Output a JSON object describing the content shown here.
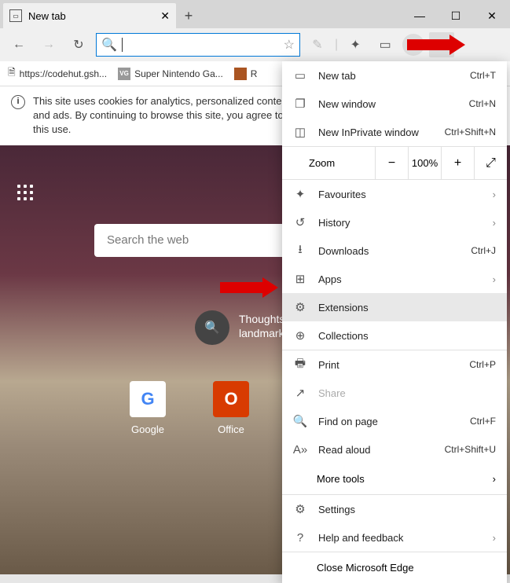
{
  "titlebar": {
    "tab_title": "New tab"
  },
  "bookmarks": [
    {
      "label": "https://codehut.gsh..."
    },
    {
      "label": "Super Nintendo Ga..."
    },
    {
      "label": "R"
    }
  ],
  "cookie_text": "This site uses cookies for analytics, personalized content and ads. By continuing to browse this site, you agree to this use.",
  "search_placeholder": "Search the web",
  "center_text1": "Thoughts",
  "center_text2": "landmarks",
  "sites": [
    {
      "label": "Google",
      "letter": "G",
      "color": "#4285F4"
    },
    {
      "label": "Office",
      "letter": "O",
      "color": "#D83B01"
    }
  ],
  "zoom": {
    "label": "Zoom",
    "value": "100%"
  },
  "menu": {
    "newtab": {
      "label": "New tab",
      "shortcut": "Ctrl+T"
    },
    "newwin": {
      "label": "New window",
      "shortcut": "Ctrl+N"
    },
    "inprivate": {
      "label": "New InPrivate window",
      "shortcut": "Ctrl+Shift+N"
    },
    "favourites": {
      "label": "Favourites"
    },
    "history": {
      "label": "History"
    },
    "downloads": {
      "label": "Downloads",
      "shortcut": "Ctrl+J"
    },
    "apps": {
      "label": "Apps"
    },
    "extensions": {
      "label": "Extensions"
    },
    "collections": {
      "label": "Collections"
    },
    "print": {
      "label": "Print",
      "shortcut": "Ctrl+P"
    },
    "share": {
      "label": "Share"
    },
    "find": {
      "label": "Find on page",
      "shortcut": "Ctrl+F"
    },
    "readaloud": {
      "label": "Read aloud",
      "shortcut": "Ctrl+Shift+U"
    },
    "moretools": {
      "label": "More tools"
    },
    "settings": {
      "label": "Settings"
    },
    "help": {
      "label": "Help and feedback"
    },
    "close": {
      "label": "Close Microsoft Edge"
    }
  }
}
